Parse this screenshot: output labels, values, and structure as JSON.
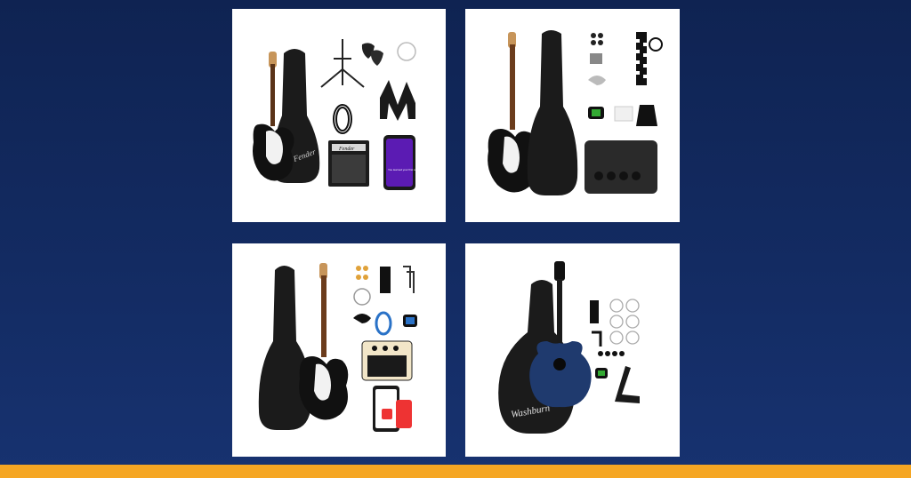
{
  "cards": [
    {
      "id": "kit-1",
      "brand_logo": "Fender",
      "amp_logo": "Fender",
      "app_screen_text": "You learned your first song on Fender!"
    },
    {
      "id": "kit-2"
    },
    {
      "id": "kit-3"
    },
    {
      "id": "kit-4",
      "brand_logo": "Washburn"
    }
  ],
  "colors": {
    "background_top": "#0f2352",
    "background_bottom": "#173270",
    "accent_bar": "#f5a623",
    "card": "#ffffff"
  }
}
